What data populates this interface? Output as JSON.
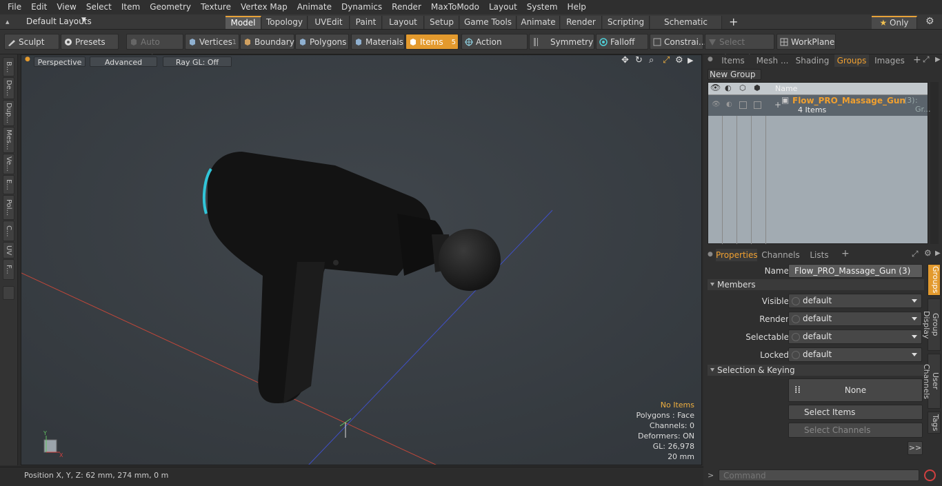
{
  "menu": [
    "File",
    "Edit",
    "View",
    "Select",
    "Item",
    "Geometry",
    "Texture",
    "Vertex Map",
    "Animate",
    "Dynamics",
    "Render",
    "MaxToModo",
    "Layout",
    "System",
    "Help"
  ],
  "layout_selector": "Default Layouts",
  "layout_tabs": [
    "Model",
    "Topology",
    "UVEdit",
    "Paint",
    "Layout",
    "Setup",
    "Game Tools",
    "Animate",
    "Render",
    "Scripting",
    "Schematic Fusion"
  ],
  "layout_active": "Model",
  "only_label": "Only",
  "toolbar": {
    "sculpt": "Sculpt",
    "presets": "Presets",
    "auto_select": "Auto Select",
    "vertices": "Vertices",
    "vertices_count": "1",
    "boundary": "Boundary",
    "polygons": "Polygons",
    "materials": "Materials",
    "items": "Items",
    "items_count": "5",
    "action_center": "Action Center",
    "symmetry": "Symmetry",
    "falloff": "Falloff",
    "constraints": "Constrai...",
    "select_through": "Select Through",
    "workplane": "WorkPlane"
  },
  "left_tabs": [
    "B...",
    "De...",
    "Dup...",
    "Mes...",
    "Ve...",
    "E...",
    "Pol...",
    "C...",
    "UV",
    "F..."
  ],
  "viewport": {
    "perspective": "Perspective",
    "advanced": "Advanced",
    "raygl": "Ray GL: Off",
    "hud": {
      "no_items": "No Items",
      "polygons": "Polygons : Face",
      "channels": "Channels: 0",
      "deformers": "Deformers: ON",
      "gl": "GL: 26,978",
      "scale": "20 mm"
    }
  },
  "status": {
    "position": "Position X, Y, Z:   62 mm, 274 mm, 0 m"
  },
  "right_tabs_top": [
    "Items",
    "Mesh ...",
    "Shading",
    "Groups",
    "Images"
  ],
  "right_tabs_top_active": "Groups",
  "groups": {
    "new_group": "New Group",
    "col_name": "Name",
    "row_name": "Flow_PRO_Massage_Gun",
    "row_count": "(3)",
    "row_type": ": Gr...",
    "row_items": "4 Items"
  },
  "right_tabs_bottom": [
    "Properties",
    "Channels",
    "Lists"
  ],
  "right_tabs_bottom_active": "Properties",
  "properties": {
    "name_label": "Name",
    "name_value": "Flow_PRO_Massage_Gun (3)",
    "members": "Members",
    "visible_label": "Visible",
    "visible_value": "default",
    "render_label": "Render",
    "render_value": "default",
    "selectable_label": "Selectable",
    "selectable_value": "default",
    "locked_label": "Locked",
    "locked_value": "default",
    "sel_keying": "Selection & Keying",
    "none": "None",
    "select_items": "Select Items",
    "select_channels": "Select Channels",
    "more": ">>"
  },
  "side_vertical_tabs": [
    "Groups",
    "Group Display",
    "User Channels",
    "Tags"
  ],
  "command_placeholder": "Command",
  "colors": {
    "accent": "#e39a2e",
    "highlight_name": "#f0a030",
    "viewport_bg": "#3a3f44",
    "list_bg": "#a2abb2"
  }
}
